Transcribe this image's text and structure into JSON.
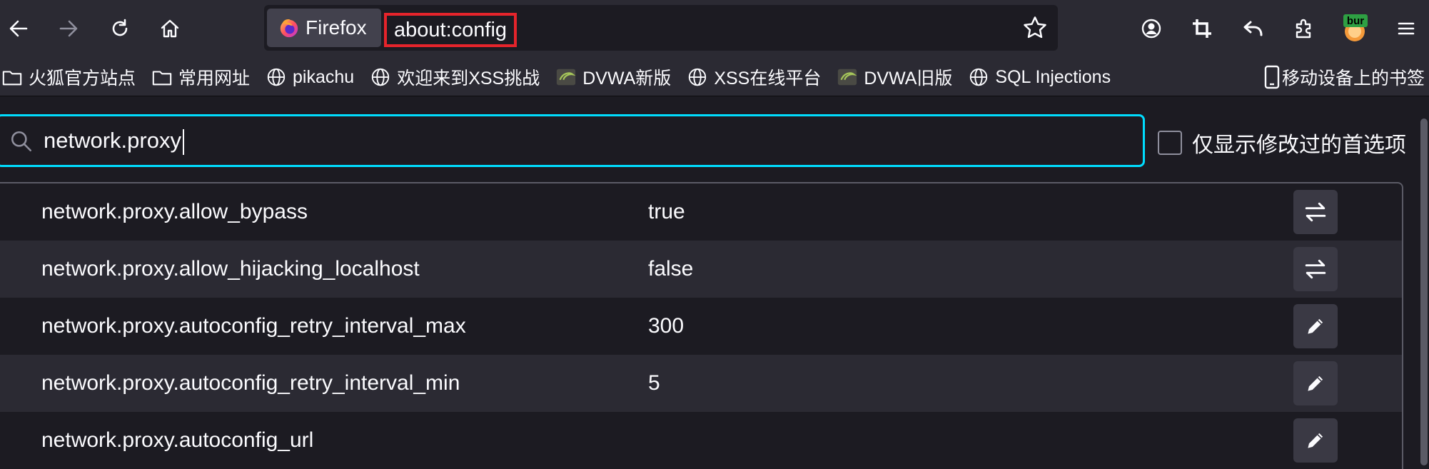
{
  "toolbar": {
    "back_icon": "back-arrow-icon",
    "forward_icon": "forward-arrow-icon",
    "reload_icon": "reload-icon",
    "home_icon": "home-icon",
    "identity_label": "Firefox",
    "url": "about:config",
    "bookmark_star_icon": "star-icon",
    "account_icon": "account-icon",
    "screenshot_icon": "crop-icon",
    "undo_icon": "undo-arrow-icon",
    "extensions_icon": "puzzle-icon",
    "burp_badge": "bur",
    "menu_icon": "hamburger-menu-icon"
  },
  "bookmarks": {
    "items": [
      {
        "label": "火狐官方站点",
        "icon": "folder-icon"
      },
      {
        "label": "常用网址",
        "icon": "folder-icon"
      },
      {
        "label": "pikachu",
        "icon": "globe-icon"
      },
      {
        "label": "欢迎来到XSS挑战",
        "icon": "globe-icon"
      },
      {
        "label": "DVWA新版",
        "icon": "dvwa-favicon"
      },
      {
        "label": "XSS在线平台",
        "icon": "globe-icon"
      },
      {
        "label": "DVWA旧版",
        "icon": "dvwa-favicon"
      },
      {
        "label": "SQL Injections",
        "icon": "globe-icon"
      }
    ],
    "mobile_label": "移动设备上的书签"
  },
  "search": {
    "value": "network.proxy",
    "modified_only_label": "仅显示修改过的首选项",
    "modified_only_checked": false
  },
  "prefs": [
    {
      "name": "network.proxy.allow_bypass",
      "value": "true",
      "action": "toggle-icon"
    },
    {
      "name": "network.proxy.allow_hijacking_localhost",
      "value": "false",
      "action": "toggle-icon"
    },
    {
      "name": "network.proxy.autoconfig_retry_interval_max",
      "value": "300",
      "action": "pencil-icon"
    },
    {
      "name": "network.proxy.autoconfig_retry_interval_min",
      "value": "5",
      "action": "pencil-icon"
    },
    {
      "name": "network.proxy.autoconfig_url",
      "value": "",
      "action": "pencil-icon"
    }
  ],
  "colors": {
    "toolbar_bg": "#2b2a33",
    "content_bg": "#1c1b22",
    "focus_ring": "#00ddff",
    "url_highlight": "#e5242b"
  }
}
